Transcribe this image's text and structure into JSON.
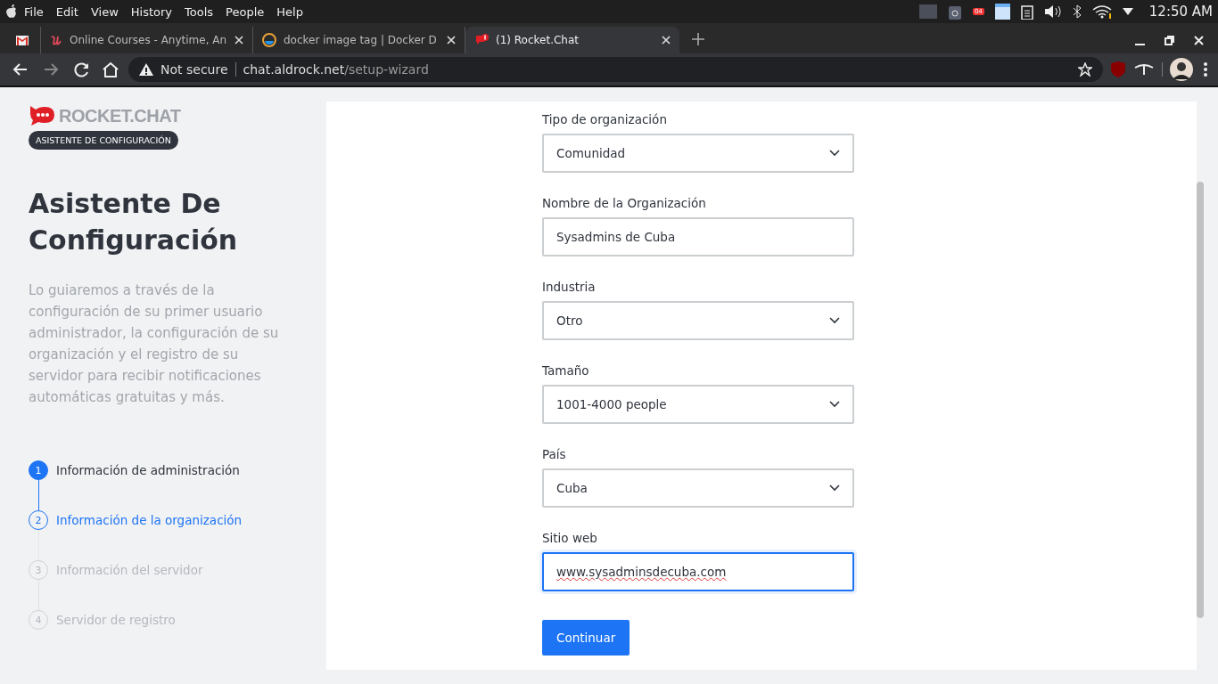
{
  "menu_bar": {
    "items": [
      "File",
      "Edit",
      "View",
      "History",
      "Tools",
      "People",
      "Help"
    ],
    "clock": "12:50 AM",
    "tray_badge": "04"
  },
  "tabs": [
    {
      "kind": "mail",
      "selected": false
    },
    {
      "title": "Online Courses - Anytime, An",
      "kind": "courses",
      "selected": false
    },
    {
      "title": "docker image tag | Docker D",
      "kind": "docker",
      "selected": false
    },
    {
      "title": "(1) Rocket.Chat",
      "kind": "rocket",
      "selected": true
    }
  ],
  "address_bar": {
    "security": "Not secure",
    "host": "chat.aldrock.net",
    "path": "/setup-wizard"
  },
  "sidebar": {
    "logo": "ROCKET.CHAT",
    "badge": "ASISTENTE DE CONFIGURACIÓN",
    "title": "Asistente De Configuración",
    "description": "Lo guiaremos a través de la configuración de su primer usuario administrador, la configuración de su organización y el registro de su servidor para recibir notificaciones automáticas gratuitas y más.",
    "steps": [
      {
        "number": "1",
        "label": "Información de administración",
        "kind": "done"
      },
      {
        "number": "2",
        "label": "Información de la organización",
        "kind": "current"
      },
      {
        "number": "3",
        "label": "Información del servidor",
        "kind": "pending"
      },
      {
        "number": "4",
        "label": "Servidor de registro",
        "kind": "pending"
      }
    ]
  },
  "form": {
    "fields": [
      {
        "label": "Tipo de organización",
        "kind": "select",
        "value": "Comunidad",
        "focused": false
      },
      {
        "label": "Nombre de la Organización",
        "kind": "text",
        "value": "Sysadmins de Cuba",
        "focused": false
      },
      {
        "label": "Industria",
        "kind": "select",
        "value": "Otro",
        "focused": false
      },
      {
        "label": "Tamaño",
        "kind": "select",
        "value": "1001-4000 people",
        "focused": false
      },
      {
        "label": "País",
        "kind": "select",
        "value": "Cuba",
        "focused": false
      },
      {
        "label": "Sitio web",
        "kind": "text",
        "value": "www.sysadminsdecuba.com",
        "focused": true
      }
    ],
    "submit": "Continuar"
  }
}
